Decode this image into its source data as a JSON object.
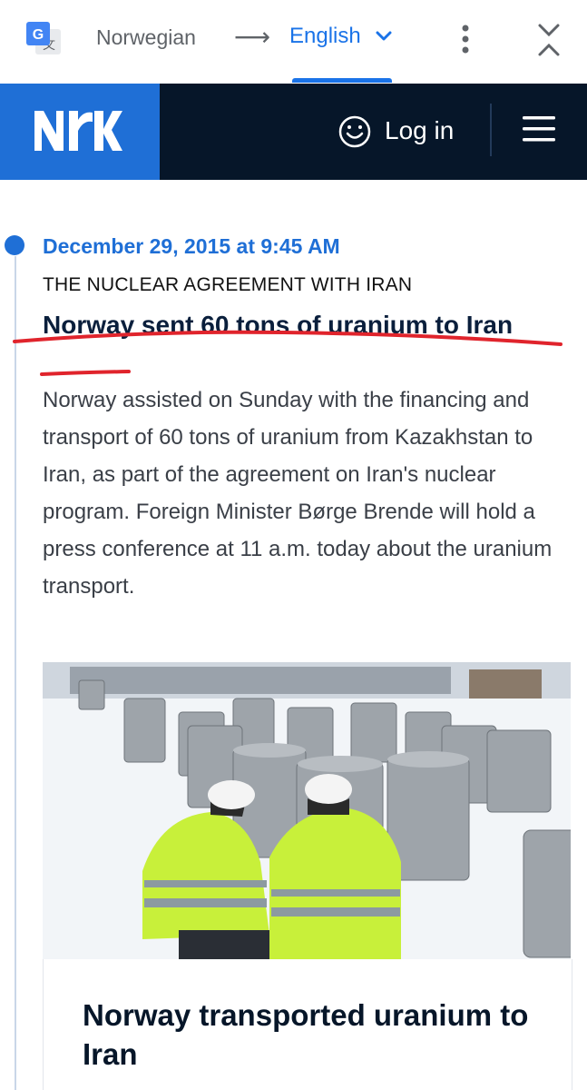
{
  "translate_bar": {
    "source_language": "Norwegian",
    "arrow": "⟶",
    "target_language": "English",
    "icons": [
      "google-translate-icon",
      "chevron-down-icon",
      "more-vert-icon",
      "collapse-icon"
    ]
  },
  "site_header": {
    "logo": "NRK",
    "login_label": "Log in",
    "icons": [
      "smiley-icon",
      "hamburger-menu-icon"
    ]
  },
  "article": {
    "date": "December 29, 2015 at 9:45 AM",
    "kicker": "THE NUCLEAR AGREEMENT WITH IRAN",
    "headline": "Norway sent 60 tons of uranium to Iran",
    "lead": "Norway assisted on Sunday with the financing and transport of 60 tons of uranium from Kazakhstan to Iran, as part of the agreement on Iran's nuclear program. Foreign Minister Børge Brende will hold a press conference at 11 a.m. today about the uranium transport.",
    "card_title": "Norway transported uranium to Iran"
  },
  "colors": {
    "nrk_blue": "#1f6fd6",
    "header_dark": "#061629",
    "google_blue": "#1a73e8",
    "annotation_red": "#e0242c"
  }
}
